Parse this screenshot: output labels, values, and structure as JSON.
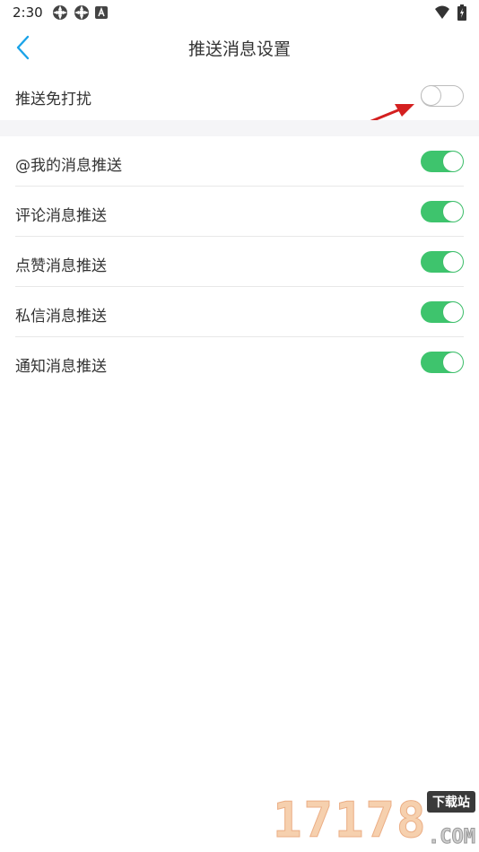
{
  "status_bar": {
    "time": "2:30",
    "left_icons": [
      "settings-gear-icon",
      "settings-gear-icon",
      "a-box-icon"
    ],
    "right_icons": [
      "wifi-icon",
      "battery-icon"
    ]
  },
  "header": {
    "back_icon": "chevron-left-icon",
    "title": "推送消息设置"
  },
  "dnd": {
    "label": "推送免打扰",
    "enabled": false
  },
  "settings": [
    {
      "label": "@我的消息推送",
      "enabled": true
    },
    {
      "label": "评论消息推送",
      "enabled": true
    },
    {
      "label": "点赞消息推送",
      "enabled": true
    },
    {
      "label": "私信消息推送",
      "enabled": true
    },
    {
      "label": "通知消息推送",
      "enabled": true
    }
  ],
  "colors": {
    "accent_blue": "#1aa3e8",
    "toggle_on": "#3ec46d",
    "toggle_off_border": "#bdbdbd",
    "annotation_red": "#d42020"
  },
  "watermark": {
    "digits": "17178",
    "badge": "下载站",
    "domain": ".COM"
  }
}
